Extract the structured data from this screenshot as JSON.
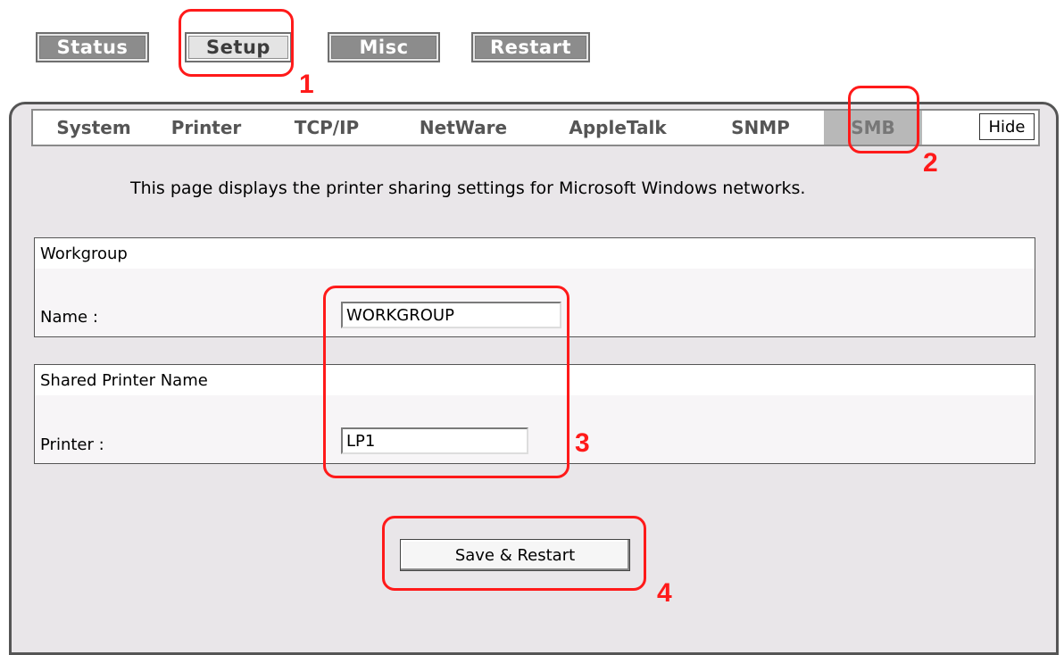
{
  "topnav": {
    "status_label": "Status",
    "setup_label": "Setup",
    "misc_label": "Misc",
    "restart_label": "Restart"
  },
  "tabs": {
    "system": "System",
    "printer": "Printer",
    "tcpip": "TCP/IP",
    "netware": "NetWare",
    "appletalk": "AppleTalk",
    "snmp": "SNMP",
    "smb": "SMB",
    "hide": "Hide"
  },
  "description": "This page displays the printer sharing settings for Microsoft Windows networks.",
  "workgroup": {
    "heading": "Workgroup",
    "name_label": "Name :",
    "name_value": "WORKGROUP"
  },
  "shared_printer": {
    "heading": "Shared Printer Name",
    "printer_label": "Printer :",
    "printer_value": "LP1"
  },
  "save_label": "Save & Restart",
  "annotations": {
    "n1": "1",
    "n2": "2",
    "n3": "3",
    "n4": "4",
    "color": "#ff1a1a"
  }
}
